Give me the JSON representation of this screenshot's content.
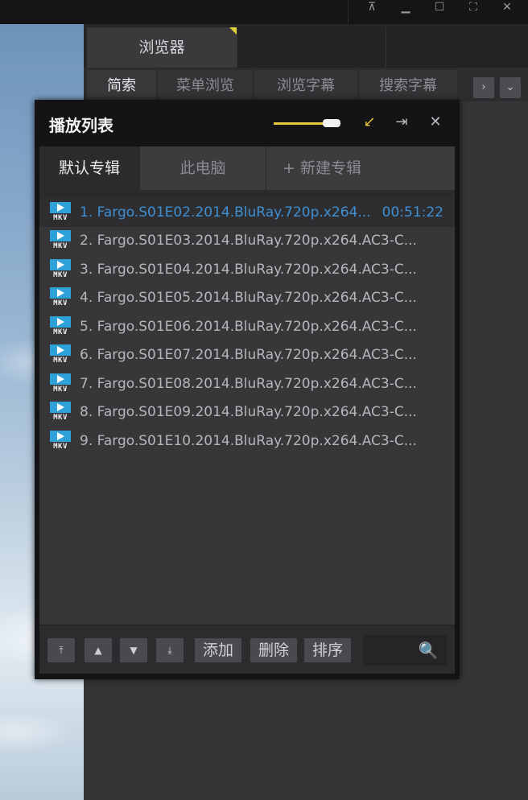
{
  "window": {
    "buttons": [
      {
        "name": "pin-icon",
        "glyph": "⊼"
      },
      {
        "name": "minimize-icon",
        "glyph": "▁"
      },
      {
        "name": "maximize-icon",
        "glyph": "☐"
      },
      {
        "name": "fullscreen-icon",
        "glyph": "⛶"
      },
      {
        "name": "close-icon",
        "glyph": "✕"
      }
    ]
  },
  "browser": {
    "tab_label": "浏览器",
    "subtabs": [
      "简索",
      "菜单浏览",
      "浏览字幕",
      "搜索字幕"
    ],
    "next_glyph": "›",
    "dropdown_glyph": "⌄"
  },
  "playlist": {
    "title": "播放列表",
    "volume_level": 0.9,
    "icons": {
      "minimize": "↙",
      "pin": "⇥",
      "close": "✕"
    },
    "tabs": [
      "默认专辑",
      "此电脑",
      "+ 新建专辑"
    ],
    "items": [
      {
        "label": "1. Fargo.S01E02.2014.BluRay.720p.x264...",
        "duration": "00:51:22",
        "selected": true
      },
      {
        "label": "2. Fargo.S01E03.2014.BluRay.720p.x264.AC3-C...",
        "duration": "",
        "selected": false
      },
      {
        "label": "3. Fargo.S01E04.2014.BluRay.720p.x264.AC3-C...",
        "duration": "",
        "selected": false
      },
      {
        "label": "4. Fargo.S01E05.2014.BluRay.720p.x264.AC3-C...",
        "duration": "",
        "selected": false
      },
      {
        "label": "5. Fargo.S01E06.2014.BluRay.720p.x264.AC3-C...",
        "duration": "",
        "selected": false
      },
      {
        "label": "6. Fargo.S01E07.2014.BluRay.720p.x264.AC3-C...",
        "duration": "",
        "selected": false
      },
      {
        "label": "7. Fargo.S01E08.2014.BluRay.720p.x264.AC3-C...",
        "duration": "",
        "selected": false
      },
      {
        "label": "8. Fargo.S01E09.2014.BluRay.720p.x264.AC3-C...",
        "duration": "",
        "selected": false
      },
      {
        "label": "9. Fargo.S01E10.2014.BluRay.720p.x264.AC3-C...",
        "duration": "",
        "selected": false
      }
    ],
    "file_badge": "MKV",
    "footer": {
      "move_top": "⤒",
      "move_up": "▲",
      "move_down": "▼",
      "move_bottom": "⤓",
      "add": "添加",
      "delete": "删除",
      "sort": "排序",
      "search_glyph": "🔍"
    }
  },
  "colors": {
    "accent_blue": "#3e8fd2",
    "volume_gold": "#e8cc45",
    "badge_blue": "#2ea1d8"
  }
}
